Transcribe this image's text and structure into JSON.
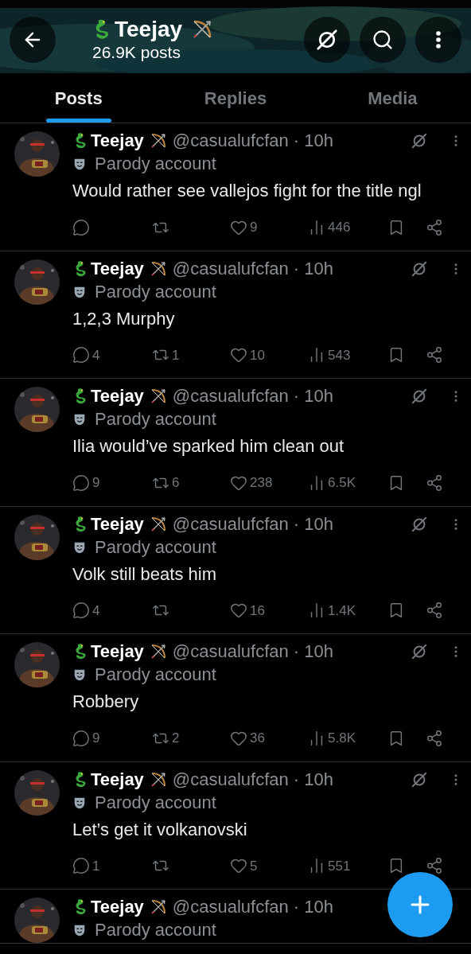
{
  "header": {
    "name": "Teejay",
    "post_count": "26.9K posts"
  },
  "tabs": [
    {
      "label": "Posts",
      "selected": true
    },
    {
      "label": "Replies",
      "selected": false
    },
    {
      "label": "Media",
      "selected": false
    }
  ],
  "posts": [
    {
      "name": "Teejay",
      "handle": "@casualufcfan",
      "time": "· 10h",
      "badge": "Parody account",
      "text": "Would rather see vallejos fight for the title ngl",
      "likes": "9",
      "views": "446"
    },
    {
      "name": "Teejay",
      "handle": "@casualufcfan",
      "time": "· 10h",
      "badge": "Parody account",
      "text": "1,2,3 Murphy",
      "replies": "4",
      "reposts": "1",
      "likes": "10",
      "views": "543"
    },
    {
      "name": "Teejay",
      "handle": "@casualufcfan",
      "time": "· 10h",
      "badge": "Parody account",
      "text": "Ilia would’ve sparked him clean out",
      "replies": "9",
      "reposts": "6",
      "likes": "238",
      "views": "6.5K"
    },
    {
      "name": "Teejay",
      "handle": "@casualufcfan",
      "time": "· 10h",
      "badge": "Parody account",
      "text": "Volk still beats him",
      "replies": "4",
      "likes": "16",
      "views": "1.4K"
    },
    {
      "name": "Teejay",
      "handle": "@casualufcfan",
      "time": "· 10h",
      "badge": "Parody account",
      "text": "Robbery",
      "replies": "9",
      "reposts": "2",
      "likes": "36",
      "views": "5.8K"
    },
    {
      "name": "Teejay",
      "handle": "@casualufcfan",
      "time": "· 10h",
      "badge": "Parody account",
      "text": "Let’s get it volkanovski",
      "replies": "1",
      "likes": "5",
      "views": "551"
    },
    {
      "name": "Teejay",
      "handle": "@casualufcfan",
      "time": "· 10h",
      "badge": "Parody account"
    }
  ]
}
